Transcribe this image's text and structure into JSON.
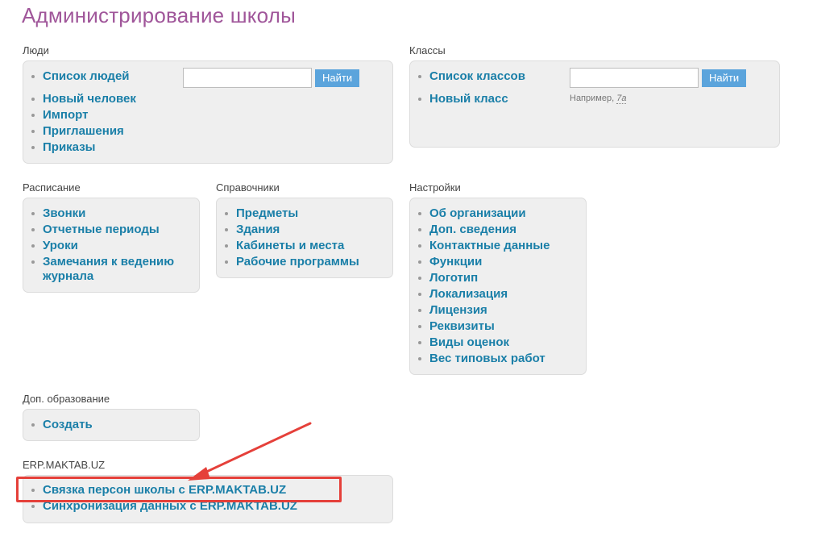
{
  "page": {
    "title": "Администрирование школы"
  },
  "people": {
    "label": "Люди",
    "items": [
      "Список людей",
      "Новый человек",
      "Импорт",
      "Приглашения",
      "Приказы"
    ],
    "search_button": "Найти",
    "search_value": ""
  },
  "classes": {
    "label": "Классы",
    "items": [
      "Список классов",
      "Новый класс"
    ],
    "search_button": "Найти",
    "search_value": "",
    "hint_prefix": "Например,",
    "hint_value": "7а"
  },
  "schedule": {
    "label": "Расписание",
    "items": [
      "Звонки",
      "Отчетные периоды",
      "Уроки",
      "Замечания к ведению журнала"
    ]
  },
  "references": {
    "label": "Справочники",
    "items": [
      "Предметы",
      "Здания",
      "Кабинеты и места",
      "Рабочие программы"
    ]
  },
  "settings": {
    "label": "Настройки",
    "items": [
      "Об организации",
      "Доп. сведения",
      "Контактные данные",
      "Функции",
      "Логотип",
      "Локализация",
      "Лицензия",
      "Реквизиты",
      "Виды оценок",
      "Вес типовых работ"
    ]
  },
  "extra_education": {
    "label": "Доп. образование",
    "items": [
      "Создать"
    ]
  },
  "erp": {
    "label": "ERP.MAKTAB.UZ",
    "items": [
      "Связка персон школы с ERP.MAKTAB.UZ",
      "Синхронизация данных с ERP.MAKTAB.UZ"
    ]
  },
  "colors": {
    "title": "#a0569a",
    "link": "#1a7fa8",
    "button": "#5ba4dc",
    "box_bg": "#efefef",
    "annotation": "#e5403a"
  },
  "icons": {
    "annotation": "red-arrow-icon"
  }
}
